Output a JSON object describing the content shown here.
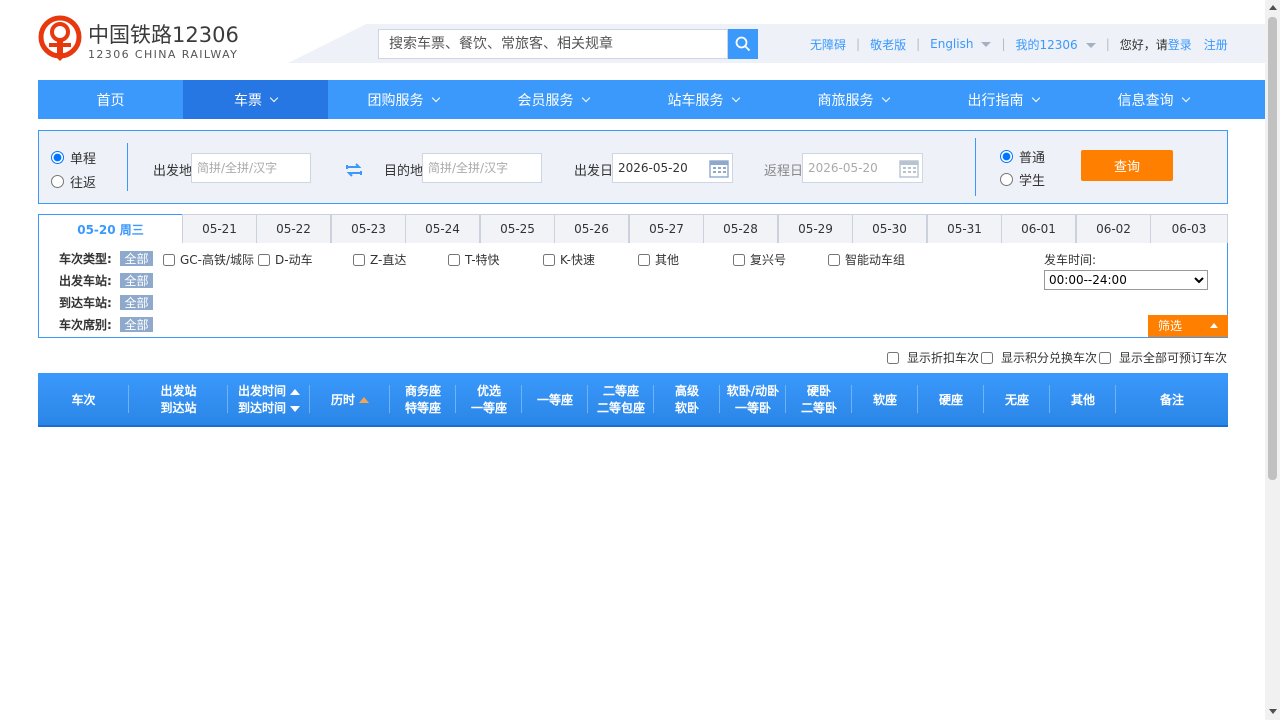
{
  "header": {
    "logo_cn": "中国铁路12306",
    "logo_en": "12306 CHINA RAILWAY",
    "search_placeholder": "搜索车票、餐饮、常旅客、相关规章",
    "links": {
      "accessibility": "无障碍",
      "elderly": "敬老版",
      "english": "English",
      "my12306": "我的12306",
      "greeting": "您好，请",
      "login": "登录",
      "register": "注册"
    }
  },
  "nav": {
    "items": [
      {
        "label": "首页"
      },
      {
        "label": "车票"
      },
      {
        "label": "团购服务"
      },
      {
        "label": "会员服务"
      },
      {
        "label": "站车服务"
      },
      {
        "label": "商旅服务"
      },
      {
        "label": "出行指南"
      },
      {
        "label": "信息查询"
      }
    ]
  },
  "query": {
    "one_way": "单程",
    "round_trip": "往返",
    "from_label": "出发地",
    "from_placeholder": "简拼/全拼/汉字",
    "to_label": "目的地",
    "to_placeholder": "简拼/全拼/汉字",
    "depart_label": "出发日",
    "depart_value": "2026-05-20",
    "return_label": "返程日",
    "return_value": "2026-05-20",
    "normal": "普通",
    "student": "学生",
    "query_button": "查询"
  },
  "dates": [
    "05-20 周三",
    "05-21",
    "05-22",
    "05-23",
    "05-24",
    "05-25",
    "05-26",
    "05-27",
    "05-28",
    "05-29",
    "05-30",
    "05-31",
    "06-01",
    "06-02",
    "06-03"
  ],
  "filter": {
    "train_type_label": "车次类型:",
    "from_station_label": "出发车站:",
    "to_station_label": "到达车站:",
    "seat_label": "车次席别:",
    "all": "全部",
    "types": [
      "GC-高铁/城际",
      "D-动车",
      "Z-直达",
      "T-特快",
      "K-快速",
      "其他",
      "复兴号",
      "智能动车组"
    ],
    "time_label": "发车时间:",
    "time_value": "00:00--24:00",
    "screen_button": "筛选"
  },
  "options": {
    "discount": "显示折扣车次",
    "points": "显示积分兑换车次",
    "all_bookable": "显示全部可预订车次"
  },
  "table": {
    "col_train": "车次",
    "col_station_1": "出发站",
    "col_station_2": "到达站",
    "col_time_1": "出发时间",
    "col_time_2": "到达时间",
    "col_duration": "历时",
    "col_business_1": "商务座",
    "col_business_2": "特等座",
    "col_premium_1": "优选",
    "col_premium_2": "一等座",
    "col_first": "一等座",
    "col_second_1": "二等座",
    "col_second_2": "二等包座",
    "col_hsoft_1": "高级",
    "col_hsoft_2": "软卧",
    "col_softsleeper_1": "软卧/动卧",
    "col_softsleeper_2": "一等卧",
    "col_hardsleeper_1": "硬卧",
    "col_hardsleeper_2": "二等卧",
    "col_softseat": "软座",
    "col_hardseat": "硬座",
    "col_noseat": "无座",
    "col_other": "其他",
    "col_remark": "备注"
  },
  "colors": {
    "primary": "#3b99fc",
    "nav_active": "#2676e3",
    "accent_orange": "#ff8000",
    "logo_red": "#e8380d"
  }
}
